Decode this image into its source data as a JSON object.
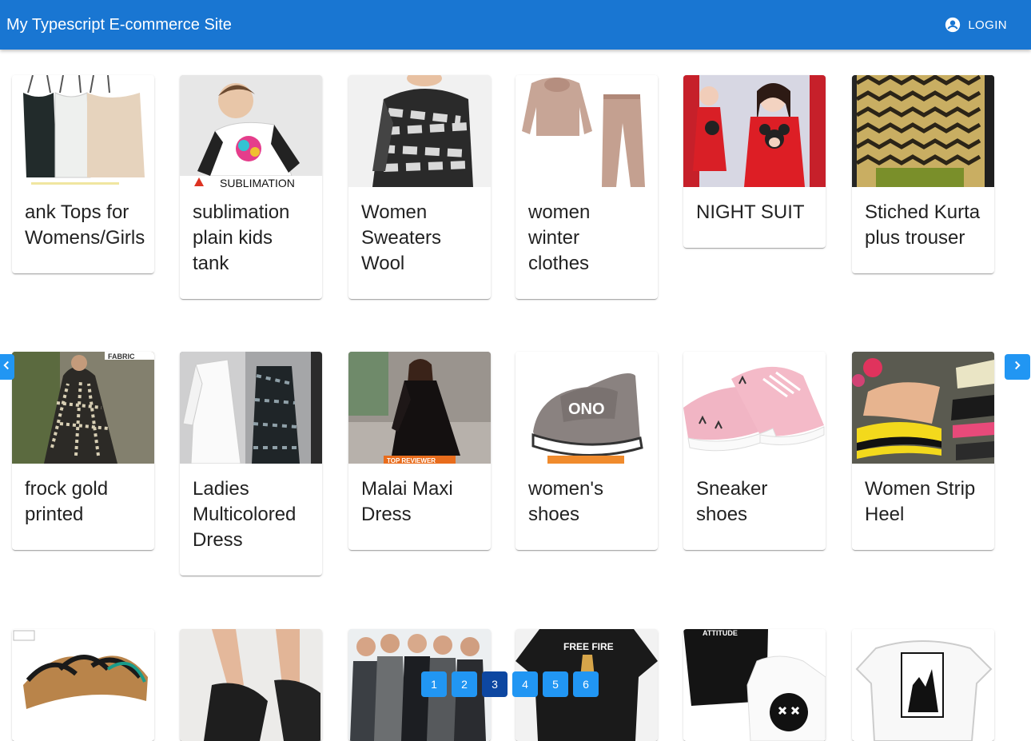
{
  "header": {
    "title": "My Typescript E-commerce Site",
    "login_label": "LOGIN"
  },
  "products_row1": [
    {
      "title": "ank Tops for Womens/Girls"
    },
    {
      "title": "sublimation plain kids tank"
    },
    {
      "title": "Women Sweaters Wool"
    },
    {
      "title": "women winter clothes"
    },
    {
      "title": "NIGHT SUIT"
    },
    {
      "title": "Stiched Kurta plus trouser"
    }
  ],
  "products_row2": [
    {
      "title": "frock gold printed"
    },
    {
      "title": "Ladies Multicolored Dress"
    },
    {
      "title": "Malai Maxi Dress"
    },
    {
      "title": "women's shoes"
    },
    {
      "title": "Sneaker shoes"
    },
    {
      "title": "Women Strip Heel"
    }
  ],
  "image_text": {
    "sublimation": "SUBLIMATION",
    "free_fire": "FREE FIRE",
    "attitude": "ATTITUDE",
    "top_reviewer": "TOP REVIEWER",
    "fabric": "FABRIC",
    "shoe_logo": "ONO"
  },
  "pagination": {
    "pages": [
      "1",
      "2",
      "3",
      "4",
      "5",
      "6"
    ],
    "active_page": "3"
  },
  "colors": {
    "appbar": "#1976d2",
    "button": "#2196f3",
    "active_page": "#0d47a1"
  },
  "icons": {
    "login": "account-circle-icon",
    "prev": "chevron-left-icon",
    "next": "chevron-right-icon"
  }
}
